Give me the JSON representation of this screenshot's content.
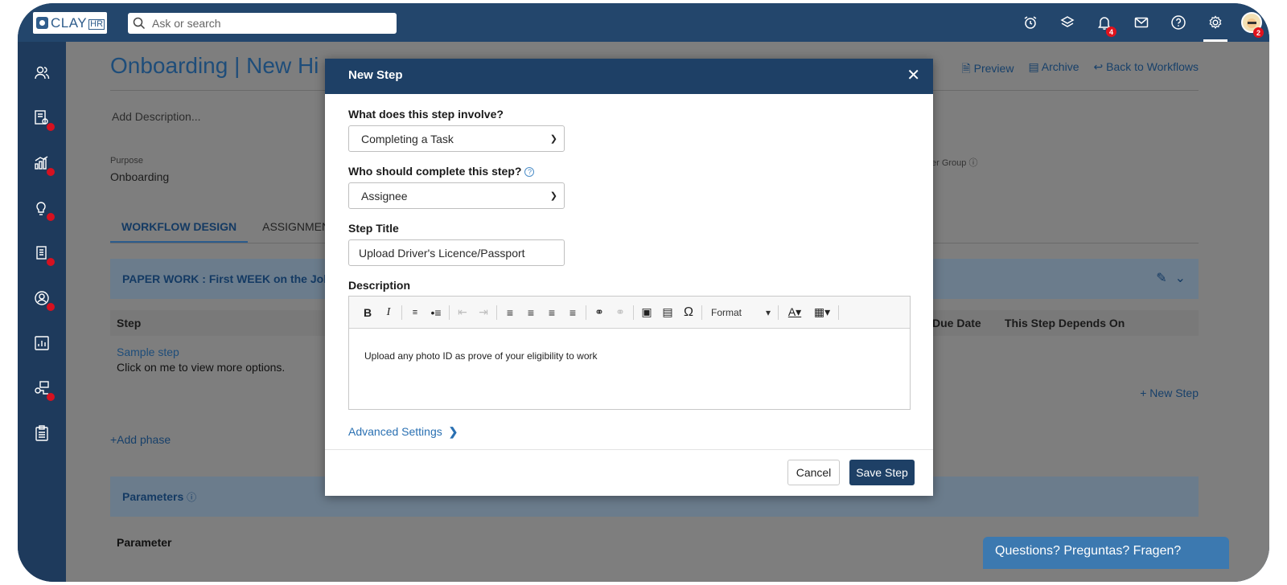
{
  "topbar": {
    "logo_text": "CLAY",
    "logo_suffix": "HR",
    "search_placeholder": "Ask or search",
    "notifications_badge": "4",
    "avatar_badge": "2"
  },
  "page": {
    "title": "Onboarding | New Hi",
    "actions": {
      "preview": "Preview",
      "archive": "Archive",
      "back": "Back to Workflows"
    },
    "description_placeholder": "Add Description...",
    "purpose_label": "Purpose",
    "purpose_value": "Onboarding",
    "manager_group_label": "er Group",
    "tabs": [
      "WORKFLOW DESIGN",
      "ASSIGNMENTS"
    ],
    "phase_title": "PAPER WORK : First WEEK on the Job",
    "table_headers": {
      "step": "Step",
      "due_date": "Due Date",
      "depends_on": "This Step Depends On"
    },
    "sample_step": "Sample step",
    "sample_step_sub": "Click on me to view more options.",
    "new_step_link": "+ New Step",
    "add_phase": "+Add phase",
    "parameters_title": "Parameters",
    "parameter_header": "Parameter"
  },
  "chat": {
    "label": "Questions? Preguntas? Fragen?"
  },
  "modal": {
    "title": "New Step",
    "involve_label": "What does this step involve?",
    "involve_value": "Completing a Task",
    "who_label": "Who should complete this step?",
    "who_value": "Assignee",
    "step_title_label": "Step Title",
    "step_title_value": "Upload Driver's Licence/Passport",
    "description_label": "Description",
    "editor_format_label": "Format",
    "editor_text": "Upload any photo ID as prove of your eligibility to work",
    "advanced_settings": "Advanced Settings",
    "cancel": "Cancel",
    "save": "Save Step"
  }
}
